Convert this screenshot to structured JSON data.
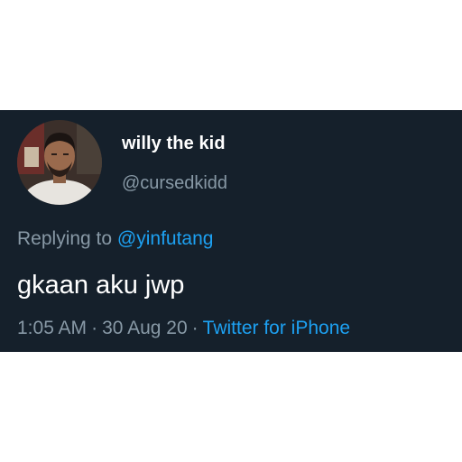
{
  "tweet": {
    "author": {
      "display_name": "willy the kid",
      "handle": "@cursedkidd"
    },
    "reply": {
      "prefix": "Replying to",
      "mention": "@yinfutang"
    },
    "text": "gkaan aku jwp",
    "meta": {
      "time": "1:05 AM",
      "separator": "·",
      "date": "30 Aug 20",
      "source": "Twitter for iPhone"
    }
  },
  "colors": {
    "card_background": "#15202b",
    "primary_text": "#ffffff",
    "secondary_text": "#8899a6",
    "accent": "#1da1f2",
    "page_background": "#ffffff"
  },
  "icons": {
    "avatar": "profile-photo"
  }
}
